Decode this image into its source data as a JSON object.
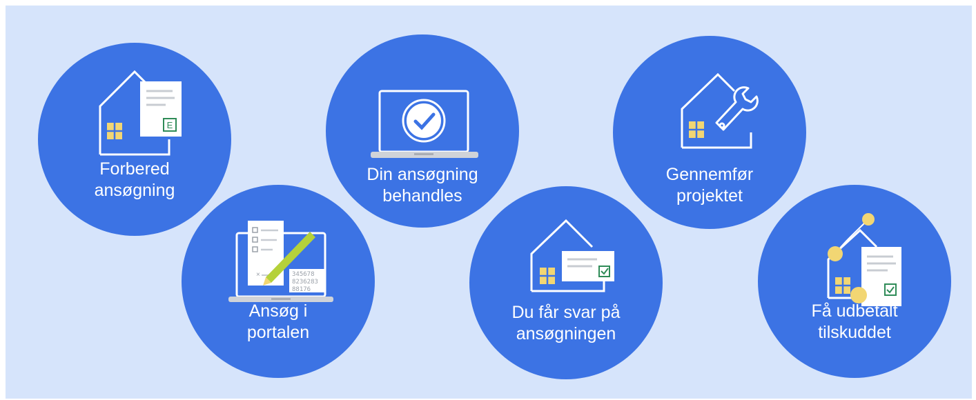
{
  "steps": [
    {
      "id": "prepare",
      "label": "Forbered\nansøgning",
      "icon": "house-document-icon",
      "doc_mark": "E"
    },
    {
      "id": "apply",
      "label": "Ansøg i\nportalen",
      "icon": "laptop-form-pencil-icon",
      "digits": [
        "345678",
        "8236283",
        "88176"
      ]
    },
    {
      "id": "processing",
      "label": "Din ansøgning\nbehandles",
      "icon": "laptop-clock-check-icon"
    },
    {
      "id": "answer",
      "label": "Du får svar på\nansøgningen",
      "icon": "house-letter-check-icon"
    },
    {
      "id": "project",
      "label": "Gennemfør\nprojektet",
      "icon": "house-wrench-icon"
    },
    {
      "id": "payout",
      "label": "Få udbetalt\ntilskuddet",
      "icon": "house-coins-document-icon"
    }
  ],
  "colors": {
    "background": "#d6e4fb",
    "circle": "#3c73e4",
    "window": "#f2d673",
    "document": "#ffffff",
    "check": "#2e8b57",
    "laptop_base": "#d0d3d8"
  }
}
